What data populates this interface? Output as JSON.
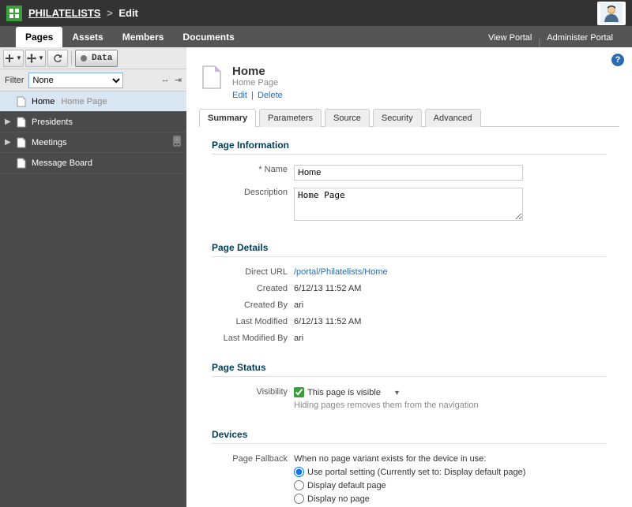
{
  "breadcrumb": {
    "portal": "PHILATELISTS",
    "current": "Edit"
  },
  "nav": {
    "tabs": [
      "Pages",
      "Assets",
      "Members",
      "Documents"
    ],
    "active": 0,
    "view_portal": "View Portal",
    "admin_portal": "Administer Portal"
  },
  "toolbar": {
    "data_label": "Data"
  },
  "filter": {
    "label": "Filter",
    "value": "None"
  },
  "tree": {
    "items": [
      {
        "name": "Home",
        "sub": "Home Page",
        "selected": true,
        "expandable": false
      },
      {
        "name": "Presidents",
        "expandable": true
      },
      {
        "name": "Meetings",
        "expandable": true,
        "device": true
      },
      {
        "name": "Message Board",
        "expandable": false
      }
    ]
  },
  "page": {
    "title": "Home",
    "subtitle": "Home Page",
    "actions": {
      "edit": "Edit",
      "delete": "Delete"
    }
  },
  "subtabs": [
    "Summary",
    "Parameters",
    "Source",
    "Security",
    "Advanced"
  ],
  "subtab_active": 0,
  "sections": {
    "info": {
      "heading": "Page Information",
      "name_label": "Name",
      "name_value": "Home",
      "desc_label": "Description",
      "desc_value": "Home Page"
    },
    "details": {
      "heading": "Page Details",
      "url_label": "Direct URL",
      "url_value": "/portal/Philatelists/Home",
      "created_label": "Created",
      "created_value": "6/12/13 11:52 AM",
      "createdby_label": "Created By",
      "createdby_value": "ari",
      "modified_label": "Last Modified",
      "modified_value": "6/12/13 11:52 AM",
      "modifiedby_label": "Last Modified By",
      "modifiedby_value": "ari"
    },
    "status": {
      "heading": "Page Status",
      "visibility_label": "Visibility",
      "visible_text": "This page is visible",
      "hint": "Hiding pages removes them from the navigation"
    },
    "devices": {
      "heading": "Devices",
      "fallback_label": "Page Fallback",
      "intro": "When no page variant exists for the device in use:",
      "options": [
        "Use portal setting (Currently set to: Display default page)",
        "Display default page",
        "Display no page"
      ]
    }
  }
}
